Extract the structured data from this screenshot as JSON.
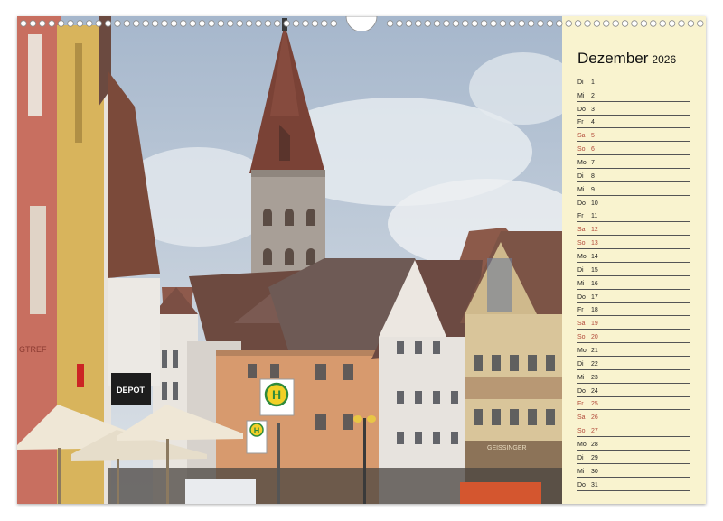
{
  "calendar": {
    "month": "Dezember",
    "year": "2026",
    "days": [
      {
        "wd": "Di",
        "d": "1",
        "weekend": false
      },
      {
        "wd": "Mi",
        "d": "2",
        "weekend": false
      },
      {
        "wd": "Do",
        "d": "3",
        "weekend": false
      },
      {
        "wd": "Fr",
        "d": "4",
        "weekend": false
      },
      {
        "wd": "Sa",
        "d": "5",
        "weekend": true
      },
      {
        "wd": "So",
        "d": "6",
        "weekend": true
      },
      {
        "wd": "Mo",
        "d": "7",
        "weekend": false
      },
      {
        "wd": "Di",
        "d": "8",
        "weekend": false
      },
      {
        "wd": "Mi",
        "d": "9",
        "weekend": false
      },
      {
        "wd": "Do",
        "d": "10",
        "weekend": false
      },
      {
        "wd": "Fr",
        "d": "11",
        "weekend": false
      },
      {
        "wd": "Sa",
        "d": "12",
        "weekend": true
      },
      {
        "wd": "So",
        "d": "13",
        "weekend": true
      },
      {
        "wd": "Mo",
        "d": "14",
        "weekend": false
      },
      {
        "wd": "Di",
        "d": "15",
        "weekend": false
      },
      {
        "wd": "Mi",
        "d": "16",
        "weekend": false
      },
      {
        "wd": "Do",
        "d": "17",
        "weekend": false
      },
      {
        "wd": "Fr",
        "d": "18",
        "weekend": false
      },
      {
        "wd": "Sa",
        "d": "19",
        "weekend": true
      },
      {
        "wd": "So",
        "d": "20",
        "weekend": true
      },
      {
        "wd": "Mo",
        "d": "21",
        "weekend": false
      },
      {
        "wd": "Di",
        "d": "22",
        "weekend": false
      },
      {
        "wd": "Mi",
        "d": "23",
        "weekend": false
      },
      {
        "wd": "Do",
        "d": "24",
        "weekend": false
      },
      {
        "wd": "Fr",
        "d": "25",
        "weekend": true
      },
      {
        "wd": "Sa",
        "d": "26",
        "weekend": true
      },
      {
        "wd": "So",
        "d": "27",
        "weekend": true
      },
      {
        "wd": "Mo",
        "d": "28",
        "weekend": false
      },
      {
        "wd": "Di",
        "d": "29",
        "weekend": false
      },
      {
        "wd": "Mi",
        "d": "30",
        "weekend": false
      },
      {
        "wd": "Do",
        "d": "31",
        "weekend": false
      }
    ]
  },
  "photo": {
    "signs": {
      "depot": "DEPOT",
      "bus_stop_large": "H",
      "bus_stop_small": "H",
      "shop_left": "GTREF",
      "shop_right": "GEISSINGER"
    }
  },
  "colors": {
    "panel_background": "#f9f3cf",
    "weekday_text": "#222222",
    "weekend_text": "#b24a3a",
    "bus_stop_sign": "#f2d027"
  }
}
